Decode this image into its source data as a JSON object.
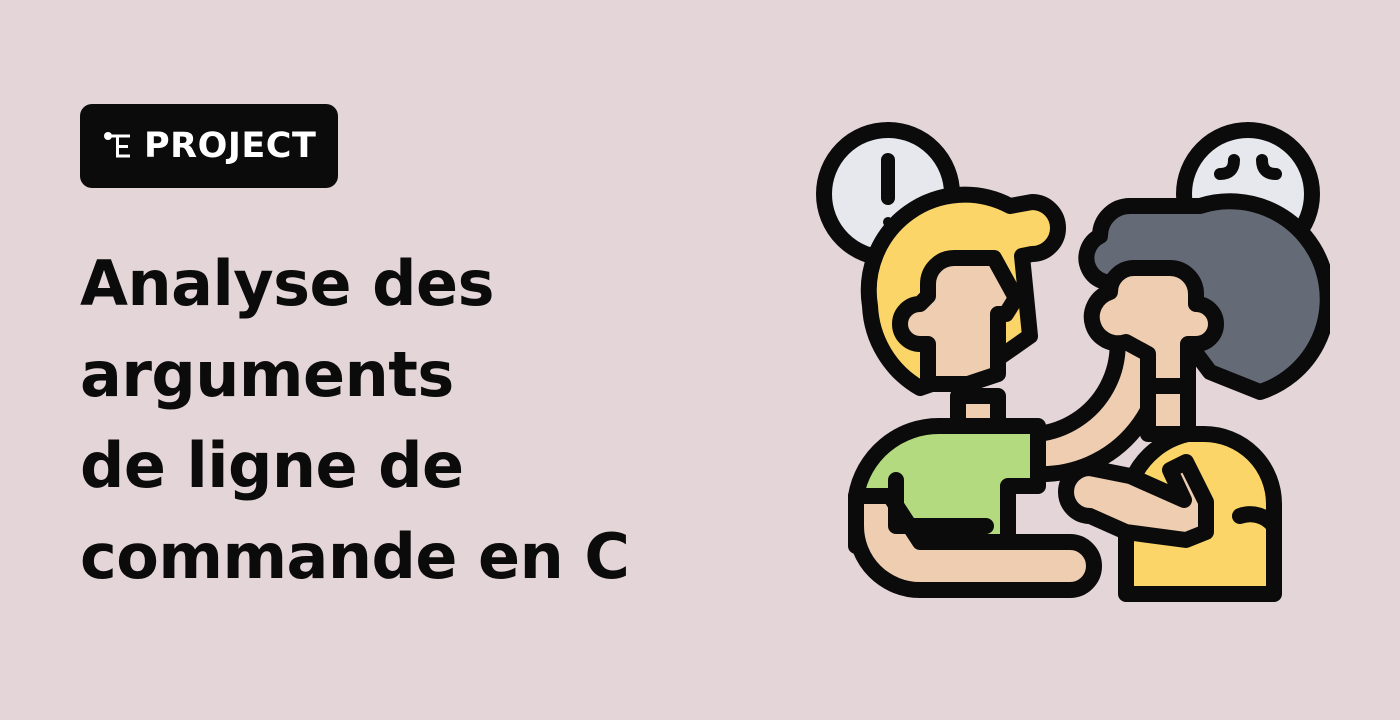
{
  "badge": {
    "icon": "project-flow-icon",
    "label": "PROJECT"
  },
  "title": {
    "lines": [
      "Analyse des",
      "arguments",
      "de ligne de",
      "commande en C"
    ]
  },
  "illustration": {
    "icon": "two-people-conflict-icon",
    "colors": {
      "background": "#e3d5d8",
      "outline": "#0b0b0b",
      "skin": "#eecdb1",
      "blond_hair": "#fbd567",
      "dark_hair": "#656a77",
      "green_shirt": "#b3da7e",
      "yellow_shirt": "#fbd567",
      "bubble": "#e6e8ed"
    }
  }
}
